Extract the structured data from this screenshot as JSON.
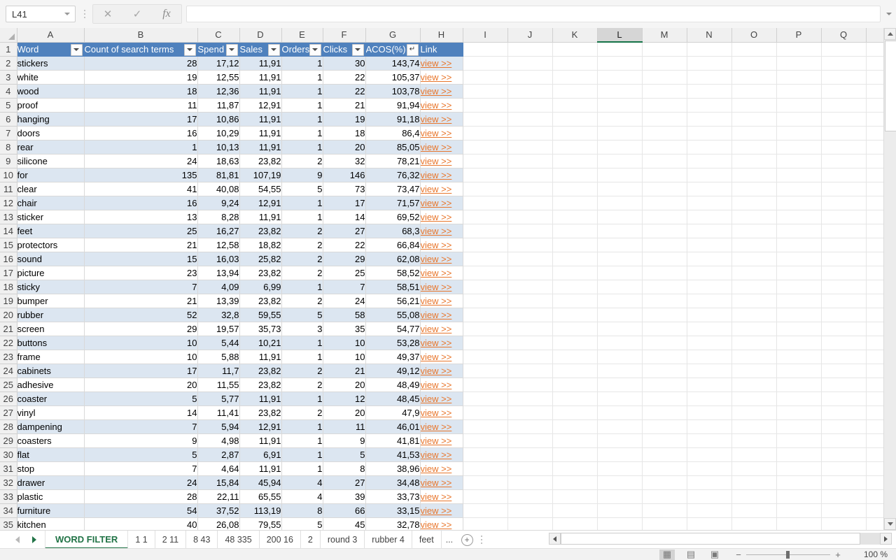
{
  "formula_bar": {
    "name_box_value": "L41",
    "cancel_icon": "close-icon",
    "enter_icon": "check-icon",
    "function_icon": "fx-icon",
    "formula_value": "",
    "expand_icon": "chevron-down-icon"
  },
  "grid": {
    "columns": [
      "A",
      "B",
      "C",
      "D",
      "E",
      "F",
      "G",
      "H",
      "I",
      "J",
      "K",
      "L",
      "M",
      "N",
      "O",
      "P",
      "Q"
    ],
    "selected_column": "L",
    "headers": [
      {
        "label": "Word",
        "filter": "dropdown"
      },
      {
        "label": "Count of search terms",
        "filter": "dropdown"
      },
      {
        "label": "Spend",
        "filter": "dropdown"
      },
      {
        "label": "Sales",
        "filter": "dropdown"
      },
      {
        "label": "Orders",
        "filter": "dropdown"
      },
      {
        "label": "Clicks",
        "filter": "dropdown"
      },
      {
        "label": "ACOS(%)",
        "filter": "sorted-desc"
      },
      {
        "label": "Link",
        "filter": "none"
      }
    ],
    "link_label": "view >>",
    "rows": [
      {
        "n": "2",
        "word": "stickers",
        "count": "28",
        "spend": "17,12",
        "sales": "11,91",
        "orders": "1",
        "clicks": "30",
        "acos": "143,74"
      },
      {
        "n": "3",
        "word": "white",
        "count": "19",
        "spend": "12,55",
        "sales": "11,91",
        "orders": "1",
        "clicks": "22",
        "acos": "105,37"
      },
      {
        "n": "4",
        "word": "wood",
        "count": "18",
        "spend": "12,36",
        "sales": "11,91",
        "orders": "1",
        "clicks": "22",
        "acos": "103,78"
      },
      {
        "n": "5",
        "word": "proof",
        "count": "11",
        "spend": "11,87",
        "sales": "12,91",
        "orders": "1",
        "clicks": "21",
        "acos": "91,94"
      },
      {
        "n": "6",
        "word": "hanging",
        "count": "17",
        "spend": "10,86",
        "sales": "11,91",
        "orders": "1",
        "clicks": "19",
        "acos": "91,18"
      },
      {
        "n": "7",
        "word": "doors",
        "count": "16",
        "spend": "10,29",
        "sales": "11,91",
        "orders": "1",
        "clicks": "18",
        "acos": "86,4"
      },
      {
        "n": "8",
        "word": "rear",
        "count": "1",
        "spend": "10,13",
        "sales": "11,91",
        "orders": "1",
        "clicks": "20",
        "acos": "85,05"
      },
      {
        "n": "9",
        "word": "silicone",
        "count": "24",
        "spend": "18,63",
        "sales": "23,82",
        "orders": "2",
        "clicks": "32",
        "acos": "78,21"
      },
      {
        "n": "10",
        "word": "for",
        "count": "135",
        "spend": "81,81",
        "sales": "107,19",
        "orders": "9",
        "clicks": "146",
        "acos": "76,32"
      },
      {
        "n": "11",
        "word": "clear",
        "count": "41",
        "spend": "40,08",
        "sales": "54,55",
        "orders": "5",
        "clicks": "73",
        "acos": "73,47"
      },
      {
        "n": "12",
        "word": "chair",
        "count": "16",
        "spend": "9,24",
        "sales": "12,91",
        "orders": "1",
        "clicks": "17",
        "acos": "71,57"
      },
      {
        "n": "13",
        "word": "sticker",
        "count": "13",
        "spend": "8,28",
        "sales": "11,91",
        "orders": "1",
        "clicks": "14",
        "acos": "69,52"
      },
      {
        "n": "14",
        "word": "feet",
        "count": "25",
        "spend": "16,27",
        "sales": "23,82",
        "orders": "2",
        "clicks": "27",
        "acos": "68,3"
      },
      {
        "n": "15",
        "word": "protectors",
        "count": "21",
        "spend": "12,58",
        "sales": "18,82",
        "orders": "2",
        "clicks": "22",
        "acos": "66,84"
      },
      {
        "n": "16",
        "word": "sound",
        "count": "15",
        "spend": "16,03",
        "sales": "25,82",
        "orders": "2",
        "clicks": "29",
        "acos": "62,08"
      },
      {
        "n": "17",
        "word": "picture",
        "count": "23",
        "spend": "13,94",
        "sales": "23,82",
        "orders": "2",
        "clicks": "25",
        "acos": "58,52"
      },
      {
        "n": "18",
        "word": "sticky",
        "count": "7",
        "spend": "4,09",
        "sales": "6,99",
        "orders": "1",
        "clicks": "7",
        "acos": "58,51"
      },
      {
        "n": "19",
        "word": "bumper",
        "count": "21",
        "spend": "13,39",
        "sales": "23,82",
        "orders": "2",
        "clicks": "24",
        "acos": "56,21"
      },
      {
        "n": "20",
        "word": "rubber",
        "count": "52",
        "spend": "32,8",
        "sales": "59,55",
        "orders": "5",
        "clicks": "58",
        "acos": "55,08"
      },
      {
        "n": "21",
        "word": "screen",
        "count": "29",
        "spend": "19,57",
        "sales": "35,73",
        "orders": "3",
        "clicks": "35",
        "acos": "54,77"
      },
      {
        "n": "22",
        "word": "buttons",
        "count": "10",
        "spend": "5,44",
        "sales": "10,21",
        "orders": "1",
        "clicks": "10",
        "acos": "53,28"
      },
      {
        "n": "23",
        "word": "frame",
        "count": "10",
        "spend": "5,88",
        "sales": "11,91",
        "orders": "1",
        "clicks": "10",
        "acos": "49,37"
      },
      {
        "n": "24",
        "word": "cabinets",
        "count": "17",
        "spend": "11,7",
        "sales": "23,82",
        "orders": "2",
        "clicks": "21",
        "acos": "49,12"
      },
      {
        "n": "25",
        "word": "adhesive",
        "count": "20",
        "spend": "11,55",
        "sales": "23,82",
        "orders": "2",
        "clicks": "20",
        "acos": "48,49"
      },
      {
        "n": "26",
        "word": "coaster",
        "count": "5",
        "spend": "5,77",
        "sales": "11,91",
        "orders": "1",
        "clicks": "12",
        "acos": "48,45"
      },
      {
        "n": "27",
        "word": "vinyl",
        "count": "14",
        "spend": "11,41",
        "sales": "23,82",
        "orders": "2",
        "clicks": "20",
        "acos": "47,9"
      },
      {
        "n": "28",
        "word": "dampening",
        "count": "7",
        "spend": "5,94",
        "sales": "12,91",
        "orders": "1",
        "clicks": "11",
        "acos": "46,01"
      },
      {
        "n": "29",
        "word": "coasters",
        "count": "9",
        "spend": "4,98",
        "sales": "11,91",
        "orders": "1",
        "clicks": "9",
        "acos": "41,81"
      },
      {
        "n": "30",
        "word": "flat",
        "count": "5",
        "spend": "2,87",
        "sales": "6,91",
        "orders": "1",
        "clicks": "5",
        "acos": "41,53"
      },
      {
        "n": "31",
        "word": "stop",
        "count": "7",
        "spend": "4,64",
        "sales": "11,91",
        "orders": "1",
        "clicks": "8",
        "acos": "38,96"
      },
      {
        "n": "32",
        "word": "drawer",
        "count": "24",
        "spend": "15,84",
        "sales": "45,94",
        "orders": "4",
        "clicks": "27",
        "acos": "34,48"
      },
      {
        "n": "33",
        "word": "plastic",
        "count": "28",
        "spend": "22,11",
        "sales": "65,55",
        "orders": "4",
        "clicks": "39",
        "acos": "33,73"
      },
      {
        "n": "34",
        "word": "furniture",
        "count": "54",
        "spend": "37,52",
        "sales": "113,19",
        "orders": "8",
        "clicks": "66",
        "acos": "33,15"
      },
      {
        "n": "35",
        "word": "kitchen",
        "count": "40",
        "spend": "26,08",
        "sales": "79,55",
        "orders": "5",
        "clicks": "45",
        "acos": "32,78"
      }
    ]
  },
  "sheet_tabs": {
    "prev_icon": "arrow-left-icon",
    "next_icon": "arrow-right-icon",
    "add_label": "+",
    "more_label": "...",
    "tabs": [
      {
        "label": "WORD FILTER",
        "active": true
      },
      {
        "label": "1 1",
        "active": false
      },
      {
        "label": "2 11",
        "active": false
      },
      {
        "label": "8 43",
        "active": false
      },
      {
        "label": "48 335",
        "active": false
      },
      {
        "label": "200 16",
        "active": false
      },
      {
        "label": "2",
        "active": false
      },
      {
        "label": "round 3",
        "active": false
      },
      {
        "label": "rubber 4",
        "active": false
      },
      {
        "label": "feet",
        "active": false
      }
    ]
  },
  "status_bar": {
    "view_normal": "normal-view-icon",
    "view_page_layout": "page-layout-view-icon",
    "view_page_break": "page-break-view-icon",
    "zoom_out_label": "−",
    "zoom_in_label": "+",
    "zoom_value": "100 %"
  },
  "colors": {
    "header_blue": "#4F81BD",
    "band_blue": "#DCE6F1",
    "link_orange": "#E8762C",
    "excel_green": "#217346"
  }
}
